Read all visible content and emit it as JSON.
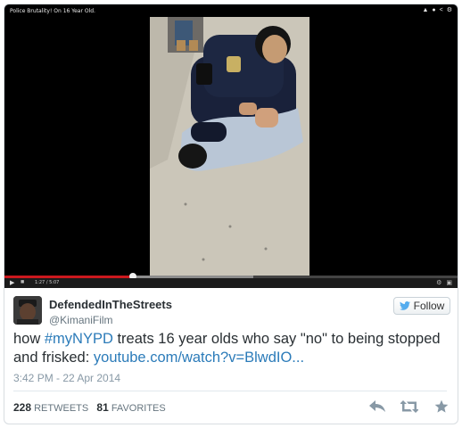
{
  "video": {
    "title": "Police Brutality! On 16 Year Old.",
    "time": "1:27 / 5:07",
    "progress_played": 0.284,
    "progress_loaded": 0.55,
    "icons": [
      "play-icon",
      "volume-icon",
      "settings-icon",
      "fullscreen-icon",
      "thumbs-up-icon",
      "info-icon",
      "share-icon"
    ]
  },
  "tweet": {
    "display_name": "DefendedInTheStreets",
    "handle": "@KimaniFilm",
    "follow_label": "Follow",
    "text_before": "how ",
    "hashtag": "#myNYPD",
    "text_mid": " treats 16 year olds who say \"no\" to being stopped and frisked: ",
    "link": "youtube.com/watch?v=BlwdIO...",
    "timestamp": "3:42 PM - 22 Apr 2014",
    "retweets_count": "228",
    "retweets_label": "RETWEETS",
    "favorites_count": "81",
    "favorites_label": "FAVORITES"
  },
  "colors": {
    "link": "#2b7bb9",
    "progress": "#cc181e",
    "twitter_blue": "#55acee"
  }
}
